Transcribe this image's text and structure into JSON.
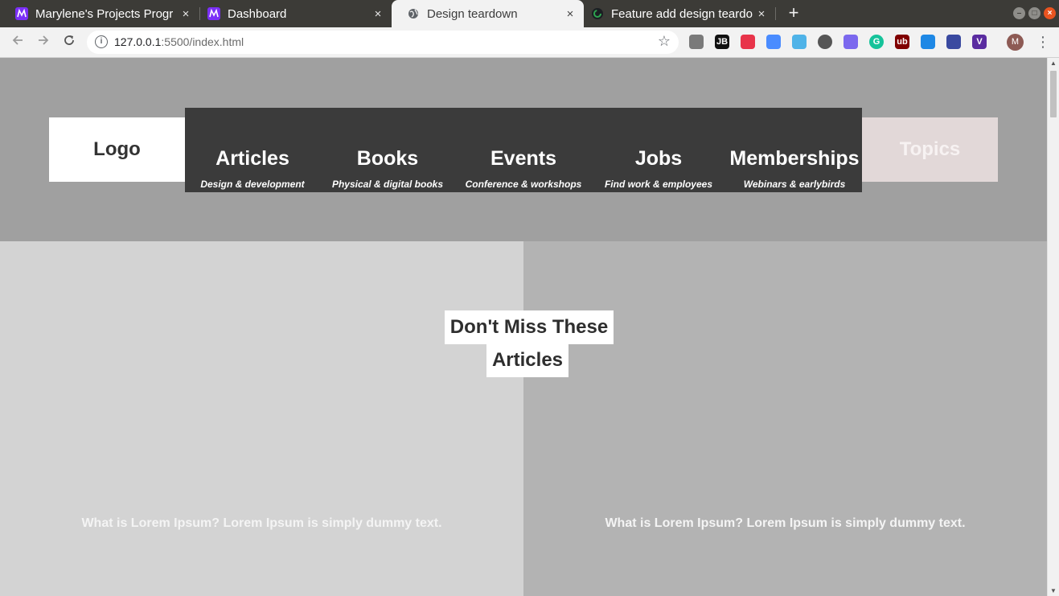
{
  "browser": {
    "tabs": [
      {
        "title": "Marylene's Projects Progr",
        "icon": "project-app-icon",
        "active": false
      },
      {
        "title": "Dashboard",
        "icon": "project-app-icon",
        "active": false
      },
      {
        "title": "Design teardown",
        "icon": "globe-icon",
        "active": true
      },
      {
        "title": "Feature add design teardo",
        "icon": "github-icon",
        "active": false
      }
    ],
    "close_glyph": "×",
    "new_tab_glyph": "+",
    "url_host": "127.0.0.1",
    "url_path": ":5500/index.html",
    "avatar_initial": "M",
    "extensions": [
      {
        "name": "camera-icon",
        "color": "#7a7a7a",
        "label": ""
      },
      {
        "name": "jetbrains-icon",
        "color": "#111111",
        "label": "JB"
      },
      {
        "name": "lastpass-icon",
        "color": "#e8344a",
        "label": ""
      },
      {
        "name": "zoom-icon",
        "color": "#4a8cff",
        "label": ""
      },
      {
        "name": "extension-icon",
        "color": "#4fb3e8",
        "label": ""
      },
      {
        "name": "grammar-check-icon",
        "color": "#555555",
        "label": ""
      },
      {
        "name": "clickup-icon",
        "color": "#7b68ee",
        "label": ""
      },
      {
        "name": "grammarly-icon",
        "color": "#15c39a",
        "label": "G"
      },
      {
        "name": "ublock-icon",
        "color": "#800000",
        "label": "ub"
      },
      {
        "name": "arrow-extension-icon",
        "color": "#1e88e5",
        "label": ""
      },
      {
        "name": "eyedropper-icon",
        "color": "#3a4aa0",
        "label": ""
      },
      {
        "name": "vimium-icon",
        "color": "#5a2ca0",
        "label": "V"
      }
    ],
    "win_controls": {
      "minimize": "–",
      "maximize": "□",
      "close": "×"
    }
  },
  "page": {
    "logo": "Logo",
    "topics": "Topics",
    "nav": [
      {
        "title": "Articles",
        "subtitle": "Design & development"
      },
      {
        "title": "Books",
        "subtitle": "Physical & digital books"
      },
      {
        "title": "Events",
        "subtitle": "Conference & workshops"
      },
      {
        "title": "Jobs",
        "subtitle": "Find work & employees"
      },
      {
        "title": "Memberships",
        "subtitle": "Webinars & earlybirds"
      }
    ],
    "heading_line1": "Don't Miss These",
    "heading_line2": "Articles",
    "left_text": "What is Lorem Ipsum? Lorem Ipsum is simply dummy text.",
    "right_text": "What is Lorem Ipsum? Lorem Ipsum is simply dummy text."
  },
  "colors": {
    "header_bg": "#a0a0a0",
    "nav_bg": "#3b3b3b",
    "topics_bg": "#e2d8d8",
    "left_col_bg": "#d3d3d3",
    "right_col_bg": "#b3b3b3"
  }
}
